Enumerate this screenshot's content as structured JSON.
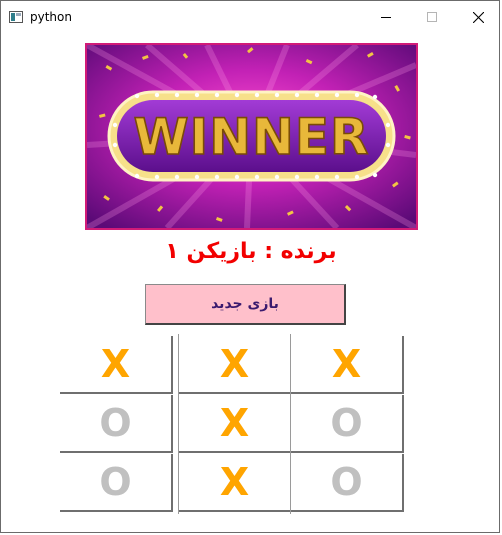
{
  "window": {
    "title": "python",
    "controls": [
      "minimize-icon",
      "maximize-icon",
      "close-icon"
    ]
  },
  "banner": {
    "text": "WINNER",
    "colors": {
      "background": "#9b1fa6",
      "border": "#d11b78",
      "text": "#e8b83a"
    }
  },
  "winner_label": "برنده : بازیکن ۱",
  "new_game_button": "بازی جدید",
  "board": {
    "rows": [
      [
        "X",
        "X",
        "X"
      ],
      [
        "O",
        "X",
        "O"
      ],
      [
        "O",
        "X",
        "O"
      ]
    ],
    "colors": {
      "X": "#ffa500",
      "O": "#c0c0c0"
    }
  }
}
